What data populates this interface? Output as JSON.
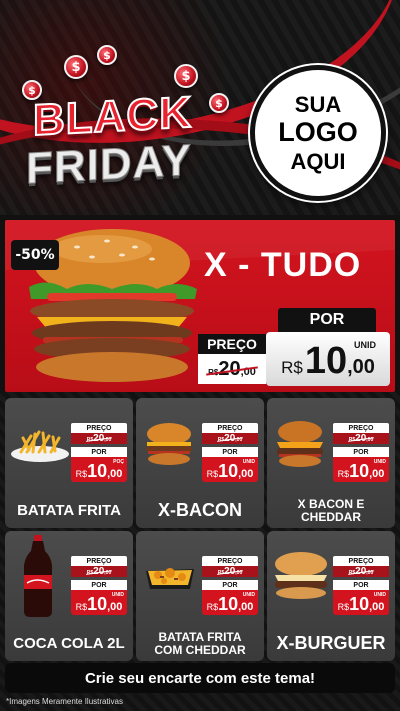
{
  "header": {
    "black": "BLACK",
    "friday": "FRIDAY",
    "logo": {
      "line1": "SUA",
      "line2": "LOGO",
      "line3": "AQUI"
    },
    "coin_symbol": "$"
  },
  "featured": {
    "discount": "-50%",
    "title": "X - TUDO",
    "preco_label": "PREÇO",
    "old_currency": "R$",
    "old_int": "20",
    "old_cents": ",00",
    "por_label": "POR",
    "unit": "UNID",
    "new_currency": "R$",
    "new_int": "10",
    "new_cents": ",00"
  },
  "products": [
    {
      "name": "BATATA FRITA",
      "preco_label": "PREÇO",
      "old_currency": "R$",
      "old_int": "20",
      "old_cents": ",00",
      "por_label": "POR",
      "unit": "POÇ",
      "new_currency": "R$",
      "new_int": "10",
      "new_cents": ",00"
    },
    {
      "name": "X-BACON",
      "preco_label": "PREÇO",
      "old_currency": "R$",
      "old_int": "20",
      "old_cents": ",00",
      "por_label": "POR",
      "unit": "UNID",
      "new_currency": "R$",
      "new_int": "10",
      "new_cents": ",00"
    },
    {
      "name_line1": "X BACON E",
      "name_line2": "CHEDDAR",
      "preco_label": "PREÇO",
      "old_currency": "R$",
      "old_int": "20",
      "old_cents": ",00",
      "por_label": "POR",
      "unit": "UNID",
      "new_currency": "R$",
      "new_int": "10",
      "new_cents": ",00"
    },
    {
      "name": "COCA COLA 2L",
      "preco_label": "PREÇO",
      "old_currency": "R$",
      "old_int": "20",
      "old_cents": ",00",
      "por_label": "POR",
      "unit": "UNID",
      "new_currency": "R$",
      "new_int": "10",
      "new_cents": ",00"
    },
    {
      "name_line1": "BATATA FRITA",
      "name_line2": "COM CHEDDAR",
      "preco_label": "PREÇO",
      "old_currency": "R$",
      "old_int": "20",
      "old_cents": ",00",
      "por_label": "POR",
      "unit": "UNID",
      "new_currency": "R$",
      "new_int": "10",
      "new_cents": ",00"
    },
    {
      "name": "X-BURGUER",
      "preco_label": "PREÇO",
      "old_currency": "R$",
      "old_int": "20",
      "old_cents": ",00",
      "por_label": "POR",
      "unit": "UNID",
      "new_currency": "R$",
      "new_int": "10",
      "new_cents": ",00"
    }
  ],
  "footer": {
    "cta": "Crie seu encarte com este tema!",
    "note": "*Imagens Meramente Ilustrativas"
  },
  "colors": {
    "accent_red": "#d3141f",
    "dark": "#111111",
    "card": "#444444",
    "white": "#ffffff"
  },
  "icons": [
    "dollar-coin-icon",
    "burger-image",
    "fries-image",
    "soda-bottle-image",
    "cheddar-fries-image"
  ]
}
